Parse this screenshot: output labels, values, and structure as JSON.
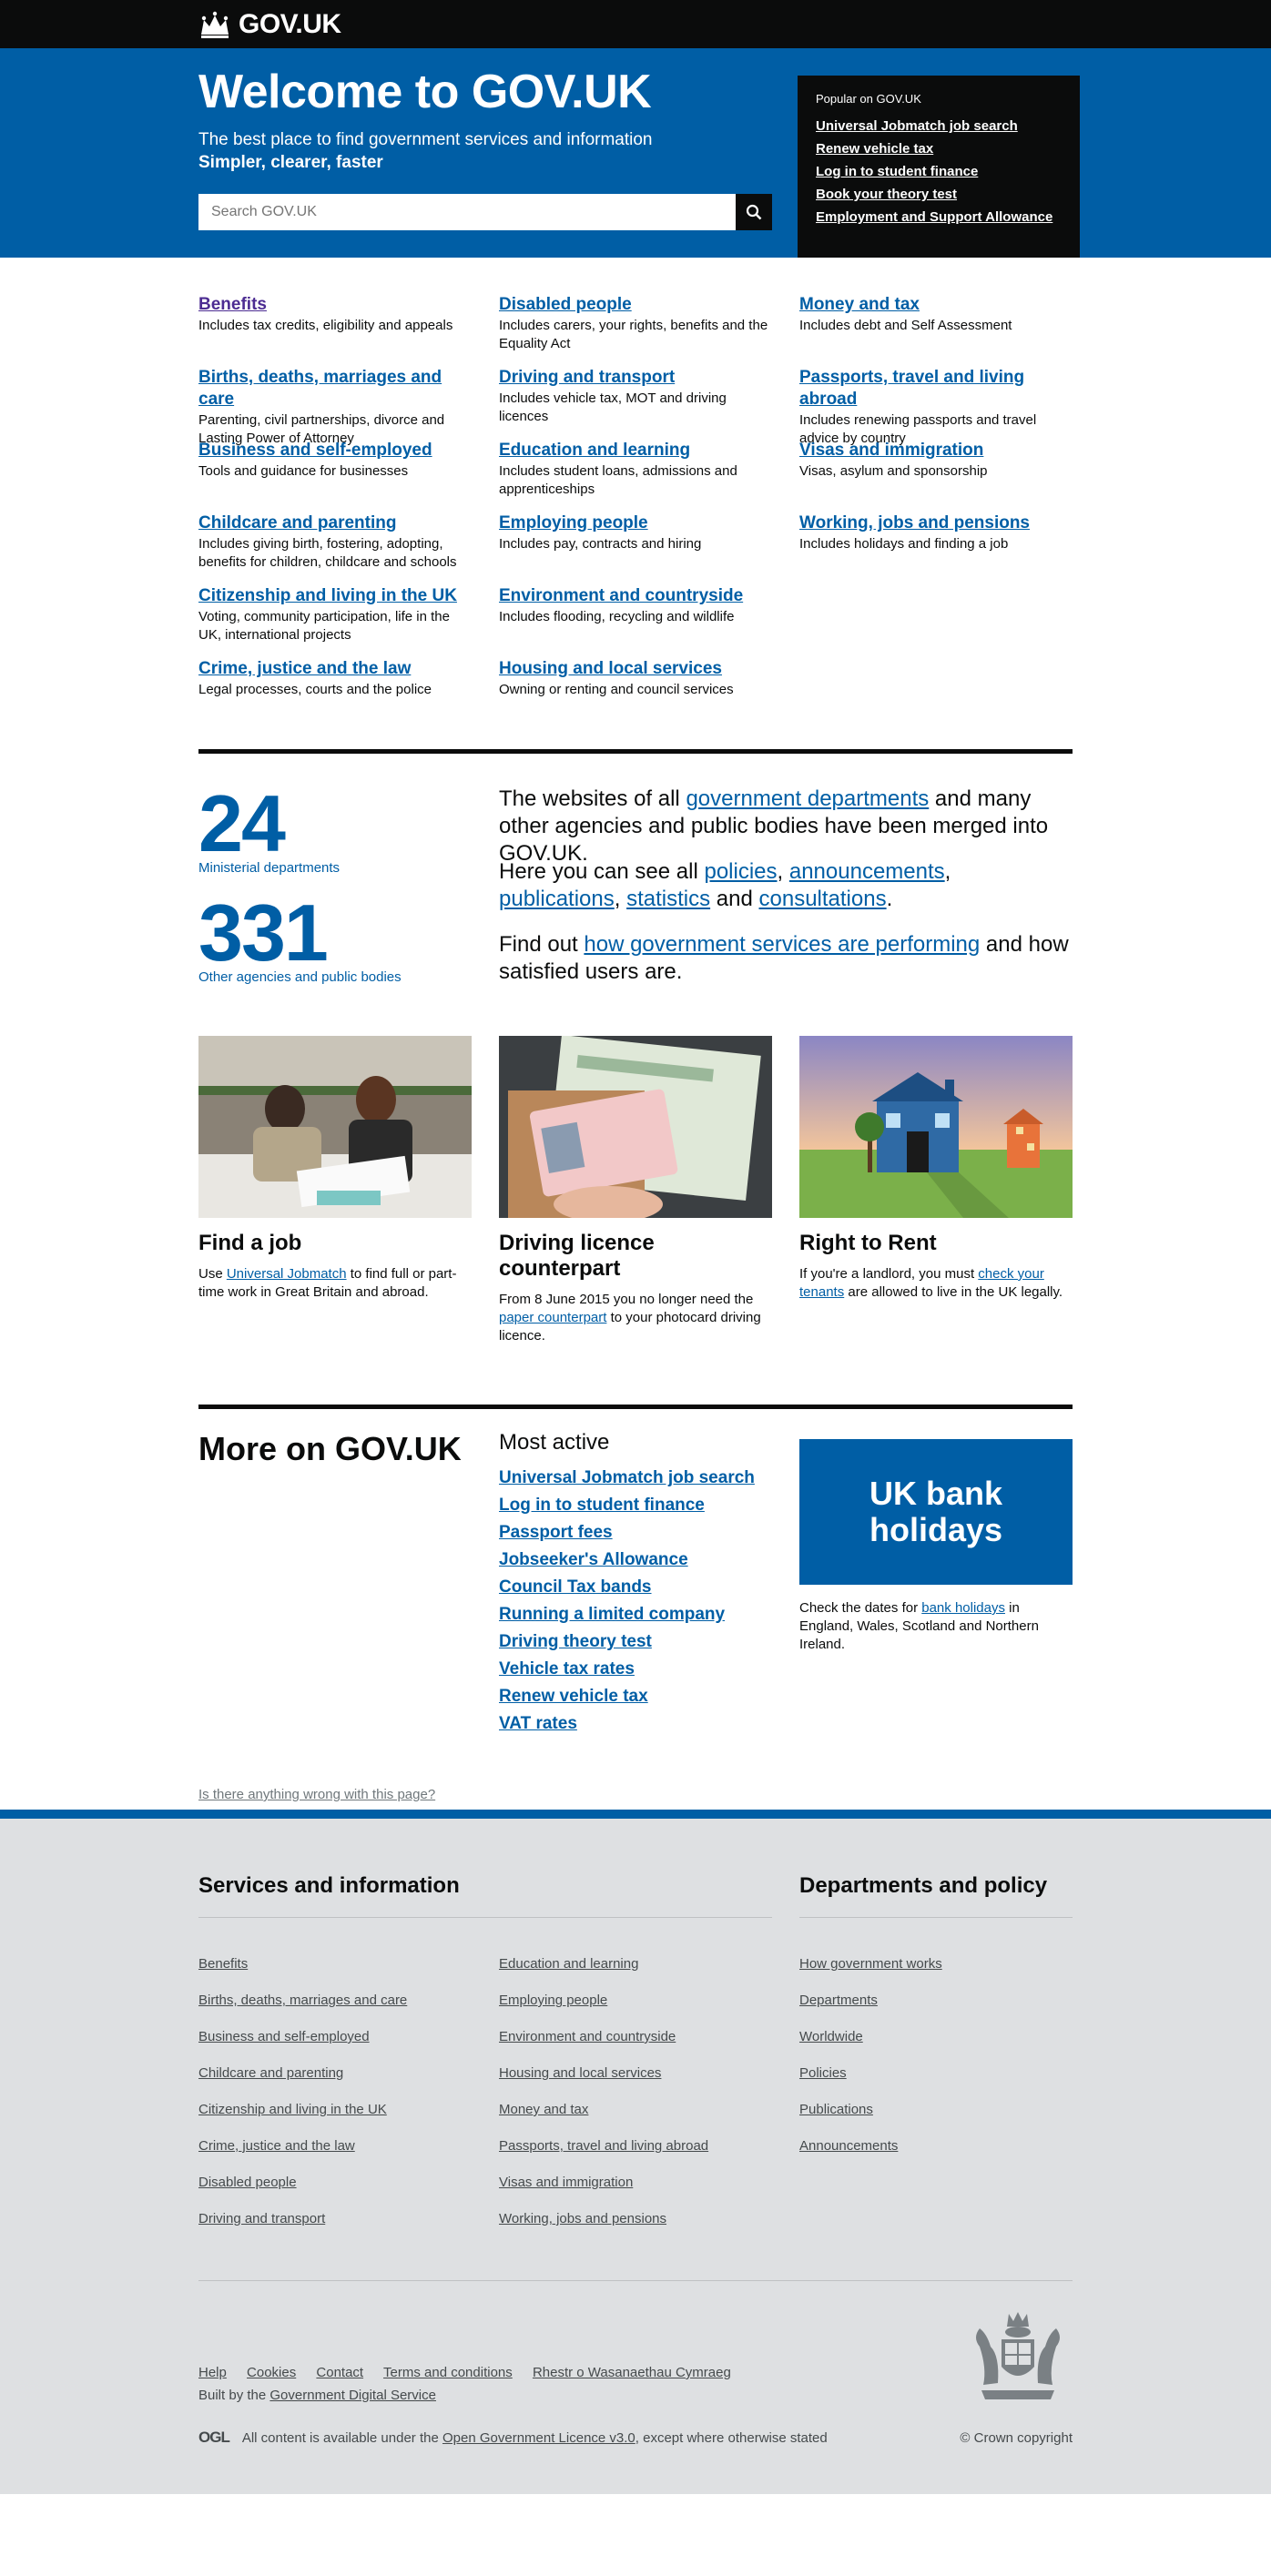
{
  "header": {
    "logo_text": "GOV.UK"
  },
  "hero": {
    "title": "Welcome to GOV.UK",
    "tagline": "The best place to find government services and information",
    "tagline_bold": "Simpler, clearer, faster",
    "search_placeholder": "Search GOV.UK"
  },
  "popular": {
    "heading": "Popular on GOV.UK",
    "links": [
      "Universal Jobmatch job search",
      "Renew vehicle tax",
      "Log in to student finance",
      "Book your theory test",
      "Employment and Support Allowance"
    ]
  },
  "topics": [
    {
      "title": "Benefits",
      "desc": "Includes tax credits, eligibility and appeals"
    },
    {
      "title": "Disabled people",
      "desc": "Includes carers, your rights, benefits and the Equality Act"
    },
    {
      "title": "Money and tax",
      "desc": "Includes debt and Self Assessment"
    },
    {
      "title": "Births, deaths, marriages and care",
      "desc": "Parenting, civil partnerships, divorce and Lasting Power of Attorney"
    },
    {
      "title": "Driving and transport",
      "desc": "Includes vehicle tax, MOT and driving licences"
    },
    {
      "title": "Passports, travel and living abroad",
      "desc": "Includes renewing passports and travel advice by country"
    },
    {
      "title": "Business and self-employed",
      "desc": "Tools and guidance for businesses"
    },
    {
      "title": "Education and learning",
      "desc": "Includes student loans, admissions and apprenticeships"
    },
    {
      "title": "Visas and immigration",
      "desc": "Visas, asylum and sponsorship"
    },
    {
      "title": "Childcare and parenting",
      "desc": "Includes giving birth, fostering, adopting, benefits for children, childcare and schools"
    },
    {
      "title": "Employing people",
      "desc": "Includes pay, contracts and hiring"
    },
    {
      "title": "Working, jobs and pensions",
      "desc": "Includes holidays and finding a job"
    },
    {
      "title": "Citizenship and living in the UK",
      "desc": "Voting, community participation, life in the UK, international projects"
    },
    {
      "title": "Environment and countryside",
      "desc": "Includes flooding, recycling and wildlife"
    },
    {
      "title": "Crime, justice and the law",
      "desc": "Legal processes, courts and the police"
    },
    {
      "title": "Housing and local services",
      "desc": "Owning or renting and council services"
    }
  ],
  "stats": {
    "ministerial_count": "24",
    "ministerial_label": "Ministerial departments",
    "other_count": "331",
    "other_label": "Other agencies and public bodies",
    "p1_a": "The websites of all ",
    "p1_link": "government departments",
    "p1_b": " and many other agencies and public bodies have been merged into GOV.UK.",
    "p2_a": "Here you can see all ",
    "p2_links": [
      "policies",
      "announcements",
      "publications",
      "statistics",
      "consultations"
    ],
    "p2_sep1": ", ",
    "p2_and": " and ",
    "p2_end": ".",
    "p3_a": "Find out ",
    "p3_link": "how government services are performing",
    "p3_b": " and how satisfied users are."
  },
  "promos": [
    {
      "title": "Find a job",
      "text_a": "Use ",
      "link": "Universal Jobmatch",
      "text_b": " to find full or part-time work in Great Britain and abroad."
    },
    {
      "title": "Driving licence counterpart",
      "text_a": "From 8 June 2015 you no longer need the ",
      "link": "paper counterpart",
      "text_b": " to your photocard driving licence."
    },
    {
      "title": "Right to Rent",
      "text_a": "If you're a landlord, you must ",
      "link": "check your tenants",
      "text_b": " are allowed to live in the UK legally."
    }
  ],
  "more": {
    "heading": "More on GOV.UK",
    "most_active_heading": "Most active",
    "most_active": [
      "Universal Jobmatch job search",
      "Log in to student finance",
      "Passport fees",
      "Jobseeker's Allowance",
      "Council Tax bands",
      "Running a limited company",
      "Driving theory test",
      "Vehicle tax rates",
      "Renew vehicle tax",
      "VAT rates"
    ],
    "bank_title": "UK bank holidays",
    "bank_text_a": "Check the dates for ",
    "bank_link": "bank holidays",
    "bank_text_b": " in England, Wales, Scotland and Northern Ireland.",
    "report": "Is there anything wrong with this page?"
  },
  "footer": {
    "services_heading": "Services and information",
    "departments_heading": "Departments and policy",
    "services_col1": [
      "Benefits",
      "Births, deaths, marriages and care",
      "Business and self-employed",
      "Childcare and parenting",
      "Citizenship and living in the UK",
      "Crime, justice and the law",
      "Disabled people",
      "Driving and transport"
    ],
    "services_col2": [
      "Education and learning",
      "Employing people",
      "Environment and countryside",
      "Housing and local services",
      "Money and tax",
      "Passports, travel and living abroad",
      "Visas and immigration",
      "Working, jobs and pensions"
    ],
    "departments": [
      "How government works",
      "Departments",
      "Worldwide",
      "Policies",
      "Publications",
      "Announcements"
    ],
    "meta_links": [
      "Help",
      "Cookies",
      "Contact",
      "Terms and conditions",
      "Rhestr o Wasanaethau Cymraeg"
    ],
    "built_by": "Built by the ",
    "built_link": "Government Digital Service",
    "ogl_logo": "OGL",
    "licence_a": "All content is available under the ",
    "licence_link": "Open Government Licence v3.0",
    "licence_b": ", except where otherwise stated",
    "copyright": "© Crown copyright"
  },
  "colors": {
    "brand_blue": "#005ea5",
    "black": "#0b0c0c",
    "visited": "#4c2c92",
    "footer_bg": "#dee0e2"
  }
}
